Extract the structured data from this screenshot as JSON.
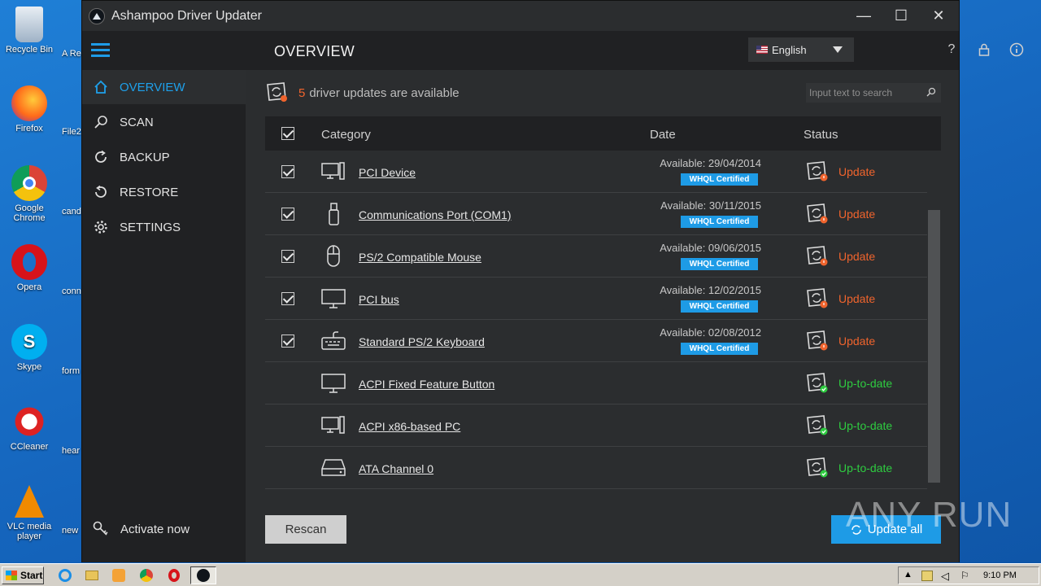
{
  "desktop": {
    "icons": [
      "Recycle Bin",
      "Firefox",
      "Google Chrome",
      "Opera",
      "Skype",
      "CCleaner",
      "VLC media player"
    ],
    "partial_icons": [
      "A\nRe",
      "File2",
      "cand",
      "conn",
      "form",
      "hear",
      "new"
    ]
  },
  "window": {
    "title": "Ashampoo Driver Updater",
    "controls": {
      "minimize": "—",
      "maximize": "☐",
      "close": "✕"
    }
  },
  "sidebar": {
    "items": [
      {
        "label": "OVERVIEW",
        "icon": "home-icon",
        "active": true
      },
      {
        "label": "SCAN",
        "icon": "search-icon",
        "active": false
      },
      {
        "label": "BACKUP",
        "icon": "backup-icon",
        "active": false
      },
      {
        "label": "RESTORE",
        "icon": "restore-icon",
        "active": false
      },
      {
        "label": "SETTINGS",
        "icon": "gear-icon",
        "active": false
      }
    ],
    "activate_label": "Activate now"
  },
  "header": {
    "title": "OVERVIEW",
    "language": "English"
  },
  "status": {
    "count": "5",
    "text": "driver updates are available"
  },
  "search": {
    "placeholder": "Input text to search"
  },
  "table": {
    "columns": {
      "category": "Category",
      "date": "Date",
      "status": "Status"
    },
    "rows": [
      {
        "name": "PCI Device",
        "available": "Available: 29/04/2014",
        "badge": "WHQL Certified",
        "status": "Update",
        "checked": true,
        "device_icon": "computer-icon"
      },
      {
        "name": "Communications Port (COM1)",
        "available": "Available: 30/11/2015",
        "badge": "WHQL Certified",
        "status": "Update",
        "checked": true,
        "device_icon": "usb-icon"
      },
      {
        "name": "PS/2 Compatible Mouse",
        "available": "Available: 09/06/2015",
        "badge": "WHQL Certified",
        "status": "Update",
        "checked": true,
        "device_icon": "mouse-icon"
      },
      {
        "name": "PCI bus",
        "available": "Available: 12/02/2015",
        "badge": "WHQL Certified",
        "status": "Update",
        "checked": true,
        "device_icon": "monitor-icon"
      },
      {
        "name": "Standard PS/2 Keyboard",
        "available": "Available: 02/08/2012",
        "badge": "WHQL Certified",
        "status": "Update",
        "checked": true,
        "device_icon": "keyboard-icon"
      },
      {
        "name": "ACPI Fixed Feature Button",
        "available": "",
        "badge": "",
        "status": "Up-to-date",
        "checked": false,
        "device_icon": "monitor-icon"
      },
      {
        "name": "ACPI x86-based PC",
        "available": "",
        "badge": "",
        "status": "Up-to-date",
        "checked": false,
        "device_icon": "computer-icon"
      },
      {
        "name": "ATA Channel 0",
        "available": "",
        "badge": "",
        "status": "Up-to-date",
        "checked": false,
        "device_icon": "drive-icon"
      }
    ]
  },
  "buttons": {
    "rescan": "Rescan",
    "update_all": "Update all"
  },
  "watermark": "ANY RUN",
  "taskbar": {
    "start": "Start",
    "clock": "9:10 PM"
  },
  "colors": {
    "accent": "#1e9be6",
    "update": "#f0642d",
    "uptodate": "#2ecc40",
    "sidebar": "#202123",
    "panel": "#2b2d2f"
  }
}
